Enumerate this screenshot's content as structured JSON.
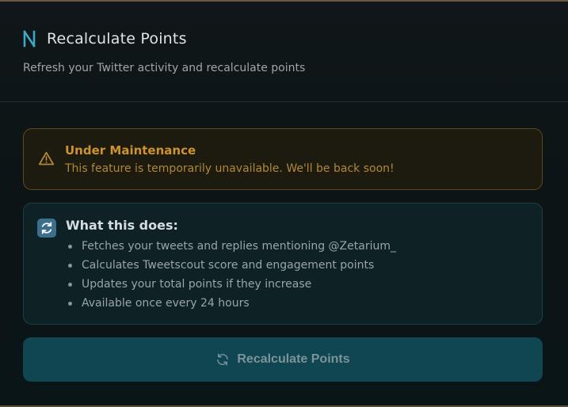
{
  "header": {
    "title": "Recalculate Points",
    "subtitle": "Refresh your Twitter activity and recalculate points"
  },
  "warning": {
    "title": "Under Maintenance",
    "message": "This feature is temporarily unavailable. We'll be back soon!"
  },
  "info": {
    "title": "What this does:",
    "items": [
      "Fetches your tweets and replies mentioning @Zetarium_",
      "Calculates Tweetscout score and engagement points",
      "Updates your total points if they increase",
      "Available once every 24 hours"
    ]
  },
  "button": {
    "label": "Recalculate Points"
  },
  "icons": {
    "logo": "logo-icon",
    "warning": "warning-triangle-icon",
    "info": "refresh-arrows-icon",
    "button": "refresh-icon"
  },
  "colors": {
    "accent": "#3fa6c4",
    "warning": "#cc9330",
    "button_bg": "#0f4652"
  }
}
